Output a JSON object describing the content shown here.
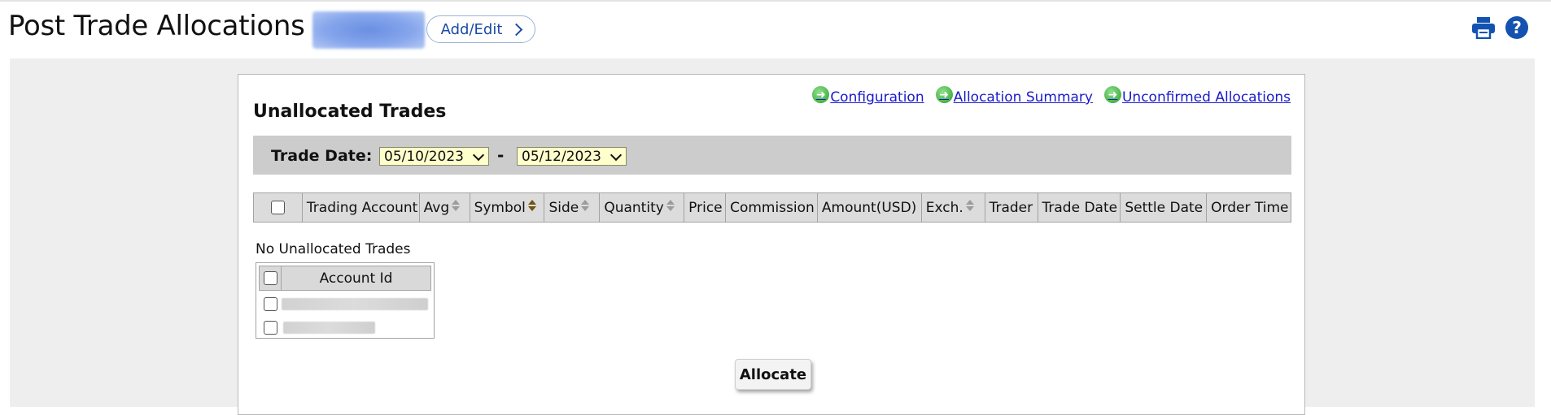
{
  "header": {
    "title": "Post Trade Allocations",
    "add_edit_label": "Add/Edit",
    "icons": {
      "print": "print-icon",
      "help": "help-icon"
    },
    "help_glyph": "?"
  },
  "panel": {
    "title": "Unallocated Trades",
    "links": [
      {
        "label": "Configuration",
        "icon": "green-arrow-icon"
      },
      {
        "label": "Allocation Summary",
        "icon": "green-arrow-icon"
      },
      {
        "label": "Unconfirmed Allocations",
        "icon": "green-arrow-icon"
      }
    ],
    "trade_date": {
      "label": "Trade Date:",
      "from": "05/10/2023",
      "separator": "-",
      "to": "05/12/2023"
    },
    "columns": [
      "Trading Account",
      "Avg",
      "Symbol",
      "Side",
      "Quantity",
      "Price",
      "Commission",
      "Amount(USD)",
      "Exch.",
      "Trader",
      "Trade Date",
      "Settle Date",
      "Order Time"
    ],
    "empty_message": "No Unallocated Trades",
    "accounts": {
      "header": "Account Id"
    },
    "allocate_label": "Allocate"
  },
  "colors": {
    "accent_blue": "#1352b0",
    "link": "#1a1acc",
    "date_select_bg": "#ffffcc",
    "filter_bar": "#cccccc",
    "page_bg": "#eeeeee"
  }
}
